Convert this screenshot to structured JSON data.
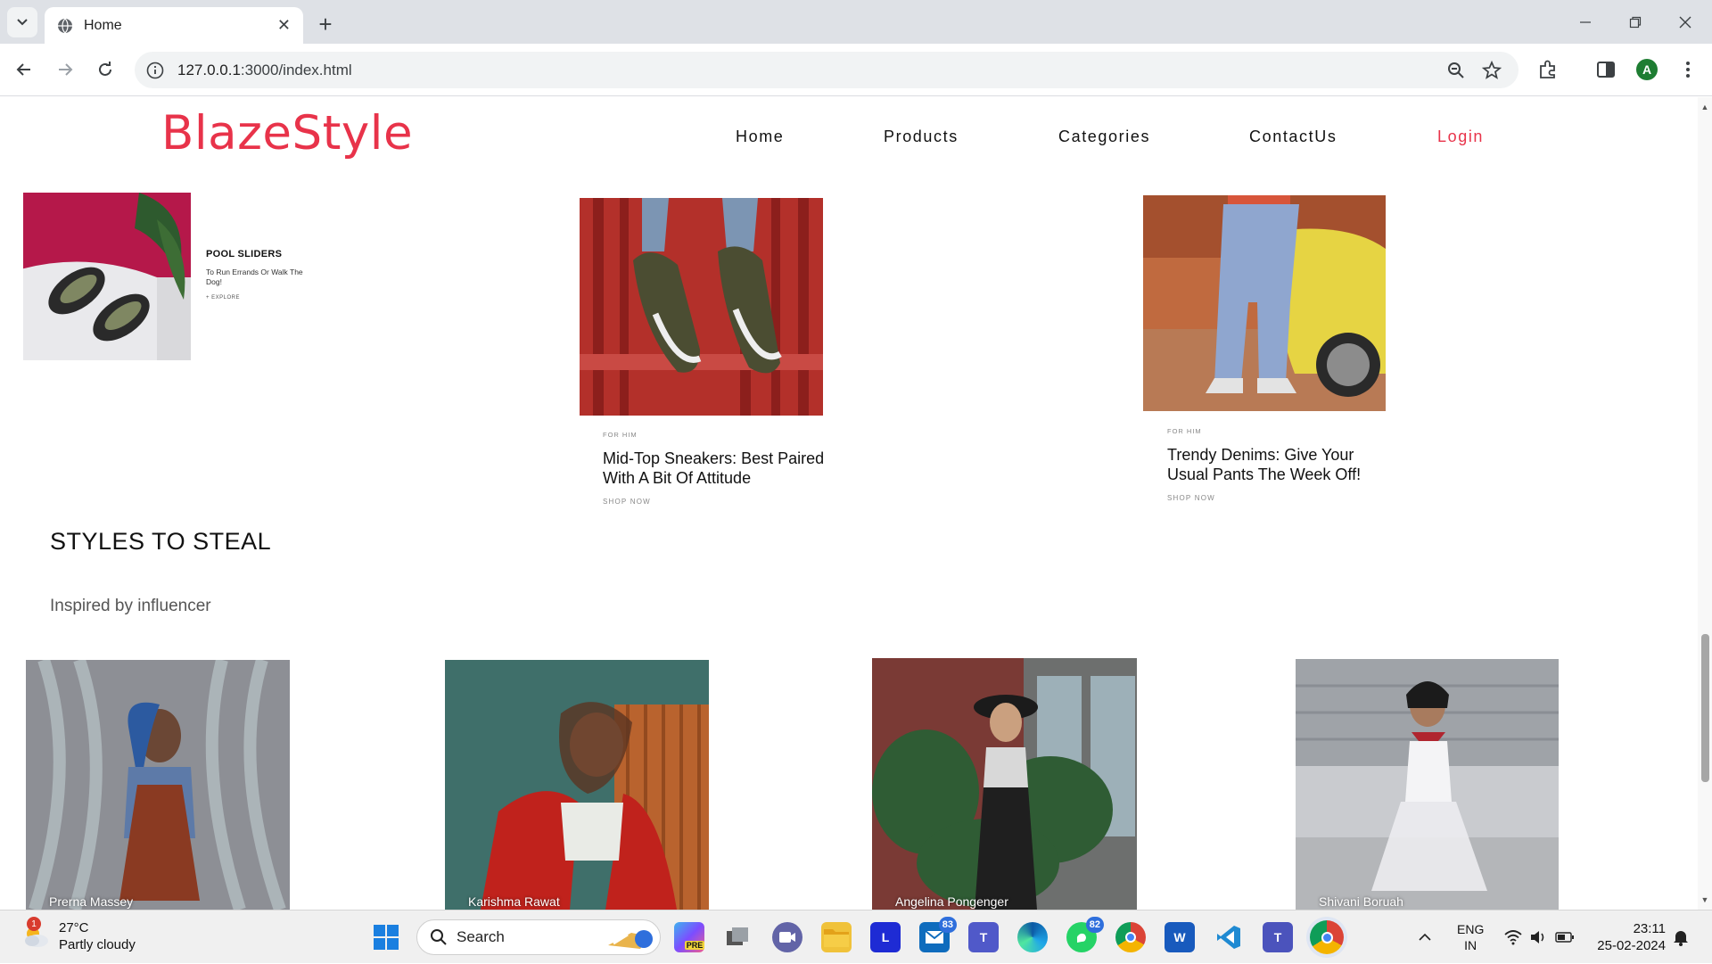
{
  "browser": {
    "tab_title": "Home",
    "url_host": "127.0.0.1",
    "url_rest": ":3000/index.html",
    "profile_initial": "A"
  },
  "site": {
    "logo": "BlazeStyle",
    "nav": [
      "Home",
      "Products",
      "Categories",
      "ContactUs",
      "Login"
    ]
  },
  "promos": {
    "pool": {
      "heading": "POOL SLIDERS",
      "sub": "To Run Errands Or Walk The Dog!",
      "cta": "+ EXPLORE"
    },
    "sneakers": {
      "tag": "FOR HIM",
      "heading": "Mid-Top Sneakers: Best Paired With A Bit Of Attitude",
      "cta": "SHOP NOW"
    },
    "denims": {
      "tag": "FOR HIM",
      "heading": "Trendy Denims:  Give Your Usual Pants The Week Off!",
      "cta": "SHOP NOW"
    }
  },
  "styles": {
    "title": "STYLES TO STEAL",
    "subtitle": "Inspired by influencer",
    "influencers": [
      "Prerna Massey",
      "Karishma Rawat",
      "Angelina Pongenger",
      "Shivani Boruah"
    ]
  },
  "taskbar": {
    "temp": "27°C",
    "condition": "Partly cloudy",
    "weather_badge": "1",
    "search_label": "Search",
    "mail_badge": "83",
    "whatsapp_badge": "82",
    "lang": "ENG",
    "region": "IN",
    "time": "23:11",
    "date": "25-02-2024"
  },
  "colors": {
    "brand": "#e8334a",
    "chrome_bg": "#dee1e6"
  }
}
